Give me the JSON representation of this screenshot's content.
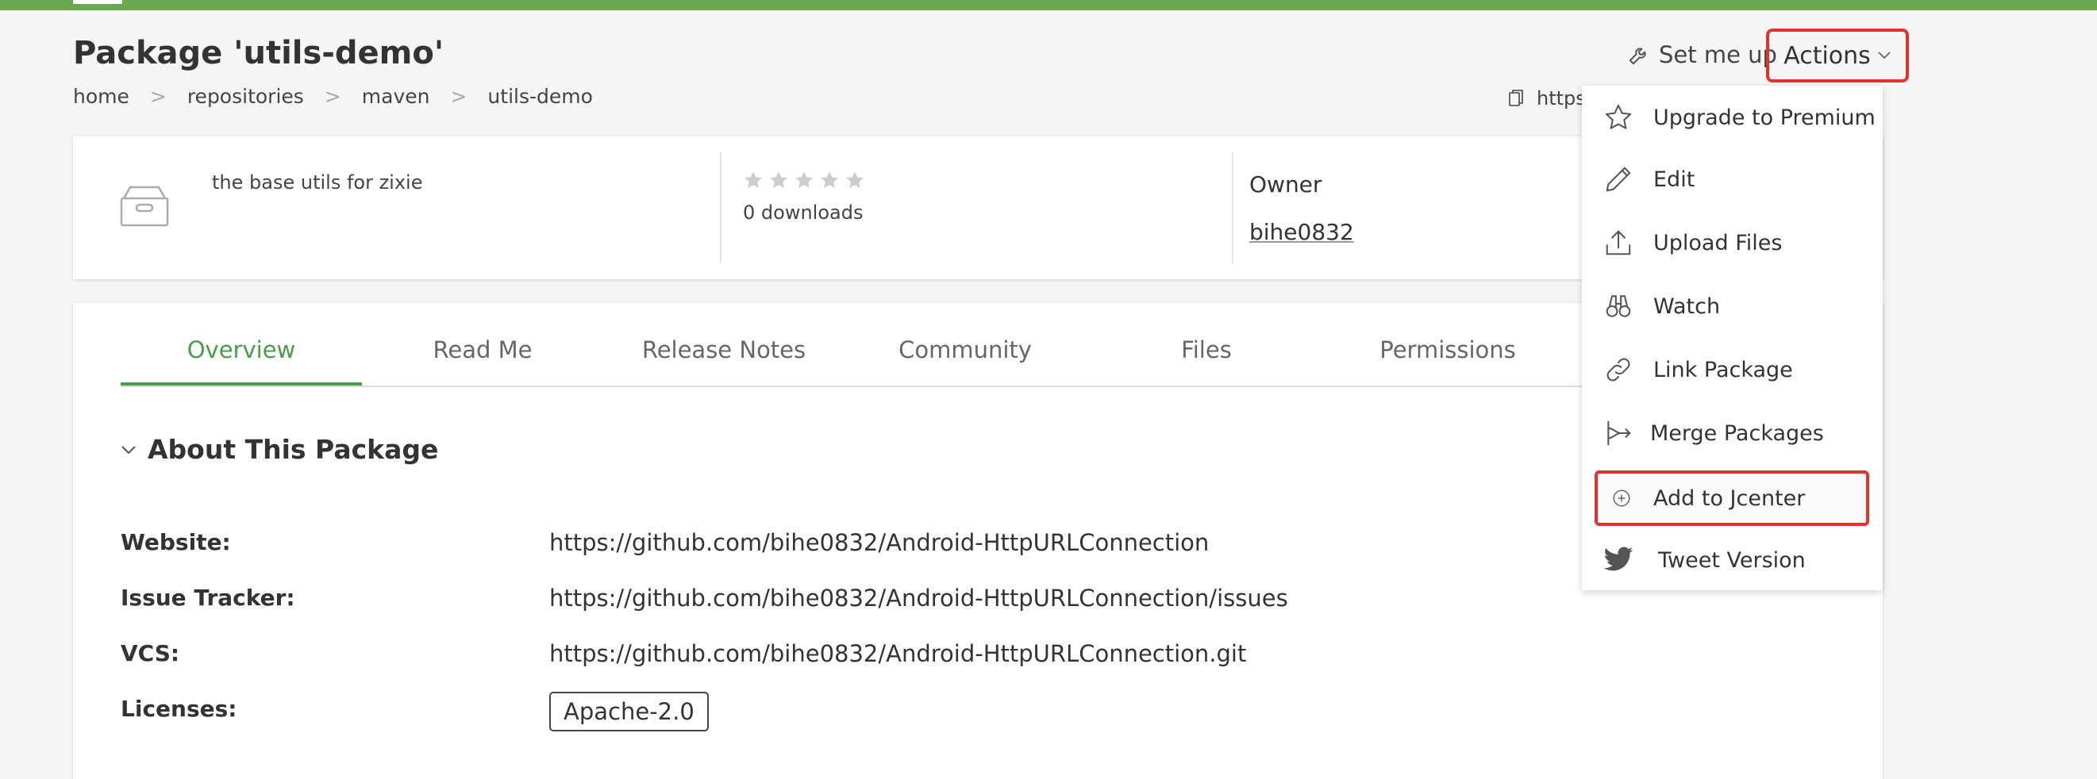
{
  "header": {
    "title": "Package 'utils-demo'",
    "breadcrumb": [
      "home",
      "repositories",
      "maven",
      "utils-demo"
    ],
    "breadcrumb_sep": ">",
    "setup_label": "Set me up",
    "actions_label": "Actions",
    "url_hint": "https"
  },
  "info": {
    "description": "the base utils for zixie",
    "rating_stars": 5,
    "downloads": "0 downloads",
    "owner_label": "Owner",
    "owner_name": "bihe0832"
  },
  "tabs": [
    "Overview",
    "Read Me",
    "Release Notes",
    "Community",
    "Files",
    "Permissions"
  ],
  "active_tab": "Overview",
  "about": {
    "heading": "About This Package",
    "fields": [
      {
        "label": "Website:",
        "value": "https://github.com/bihe0832/Android-HttpURLConnection"
      },
      {
        "label": "Issue Tracker:",
        "value": "https://github.com/bihe0832/Android-HttpURLConnection/issues"
      },
      {
        "label": "VCS:",
        "value": "https://github.com/bihe0832/Android-HttpURLConnection.git"
      },
      {
        "label": "Licenses:",
        "value": "Apache-2.0"
      }
    ]
  },
  "actions_menu": [
    {
      "label": "Upgrade to Premium",
      "icon": "star-icon"
    },
    {
      "label": "Edit",
      "icon": "pencil-icon"
    },
    {
      "label": "Upload Files",
      "icon": "upload-icon"
    },
    {
      "label": "Watch",
      "icon": "binoculars-icon"
    },
    {
      "label": "Link Package",
      "icon": "link-icon"
    },
    {
      "label": "Merge Packages",
      "icon": "merge-icon"
    },
    {
      "label": "Add to Jcenter",
      "icon": "plus-circle-icon"
    },
    {
      "label": "Tweet Version",
      "icon": "twitter-icon"
    }
  ],
  "colors": {
    "brand_green": "#6aa84f",
    "active_tab": "#4c9b4c",
    "highlight_red": "#e0332b"
  }
}
